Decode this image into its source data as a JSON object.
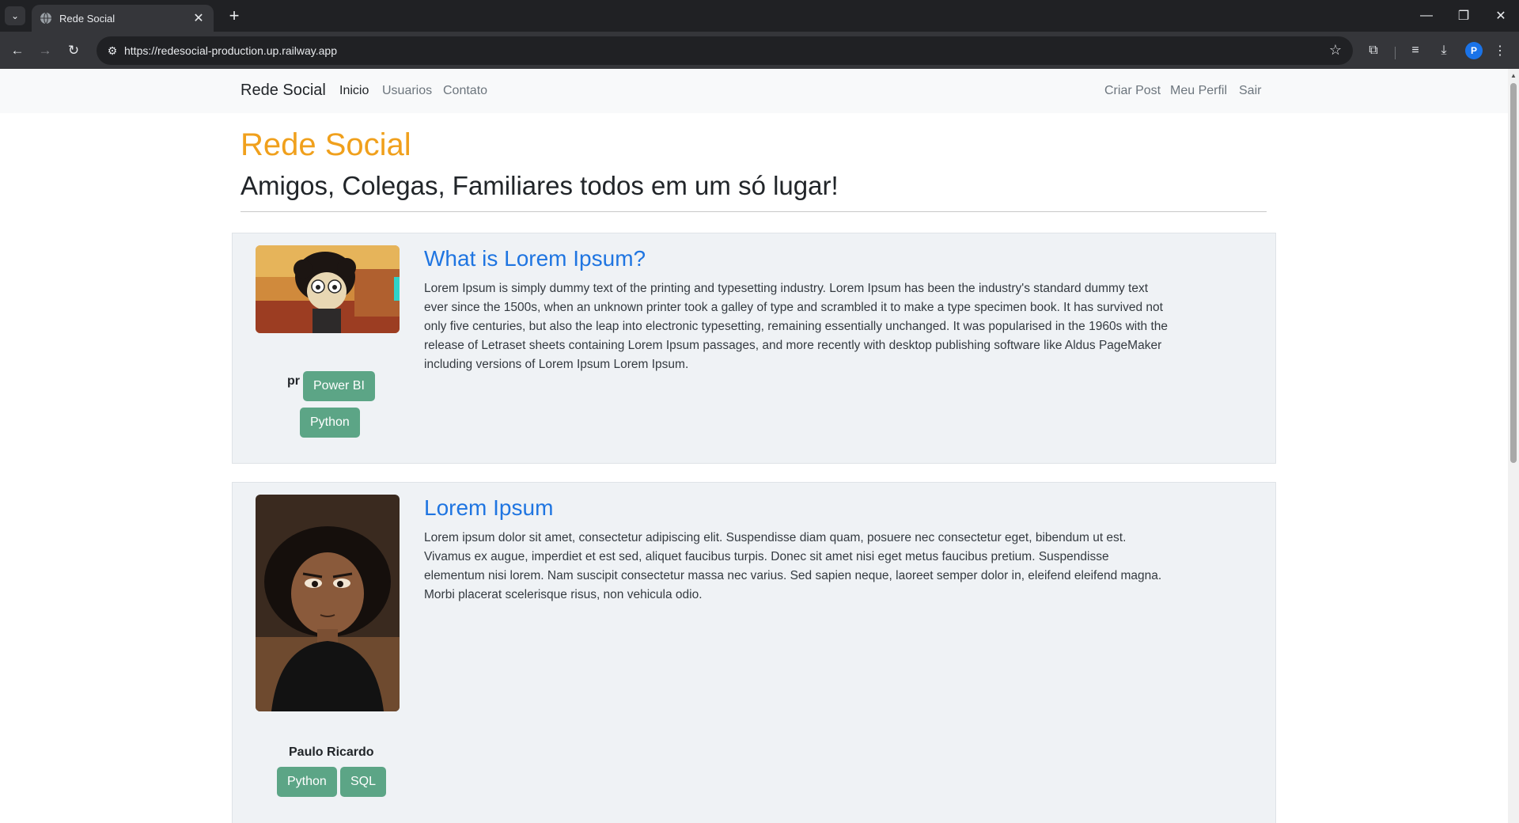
{
  "browser": {
    "tab_title": "Rede Social",
    "url": "https://redesocial-production.up.railway.app",
    "profile_initial": "P"
  },
  "site": {
    "brand": "Rede Social",
    "nav_left": [
      "Inicio",
      "Usuarios",
      "Contato"
    ],
    "nav_right": [
      "Criar Post",
      "Meu Perfil",
      "Sair"
    ],
    "active_nav": "Inicio"
  },
  "hero": {
    "title": "Rede Social",
    "subtitle": "Amigos, Colegas, Familiares todos em um só lugar!"
  },
  "posts": [
    {
      "title": "What is Lorem Ipsum?",
      "body": "Lorem Ipsum is simply dummy text of the printing and typesetting industry. Lorem Ipsum has been the industry's standard dummy text ever since the 1500s, when an unknown printer took a galley of type and scrambled it to make a type specimen book. It has survived not only five centuries, but also the leap into electronic typesetting, remaining essentially unchanged. It was popularised in the 1960s with the release of Letraset sheets containing Lorem Ipsum passages, and more recently with desktop publishing software like Aldus PageMaker including versions of Lorem Ipsum Lorem Ipsum.",
      "author": "pr",
      "tags": [
        "Power BI",
        "Python"
      ]
    },
    {
      "title": "Lorem Ipsum",
      "body": "Lorem ipsum dolor sit amet, consectetur adipiscing elit. Suspendisse diam quam, posuere nec consectetur eget, bibendum ut est. Vivamus ex augue, imperdiet et est sed, aliquet faucibus turpis. Donec sit amet nisi eget metus faucibus pretium. Suspendisse elementum nisi lorem. Nam suscipit consectetur massa nec varius. Sed sapien neque, laoreet semper dolor in, eleifend eleifend magna. Morbi placerat scelerisque risus, non vehicula odio.",
      "author": "Paulo Ricardo",
      "tags": [
        "Python",
        "SQL"
      ]
    }
  ],
  "colors": {
    "accent_orange": "#f0a01c",
    "post_title_blue": "#1f75e1",
    "tag_green": "#5ca586",
    "card_bg": "#eff2f5"
  }
}
